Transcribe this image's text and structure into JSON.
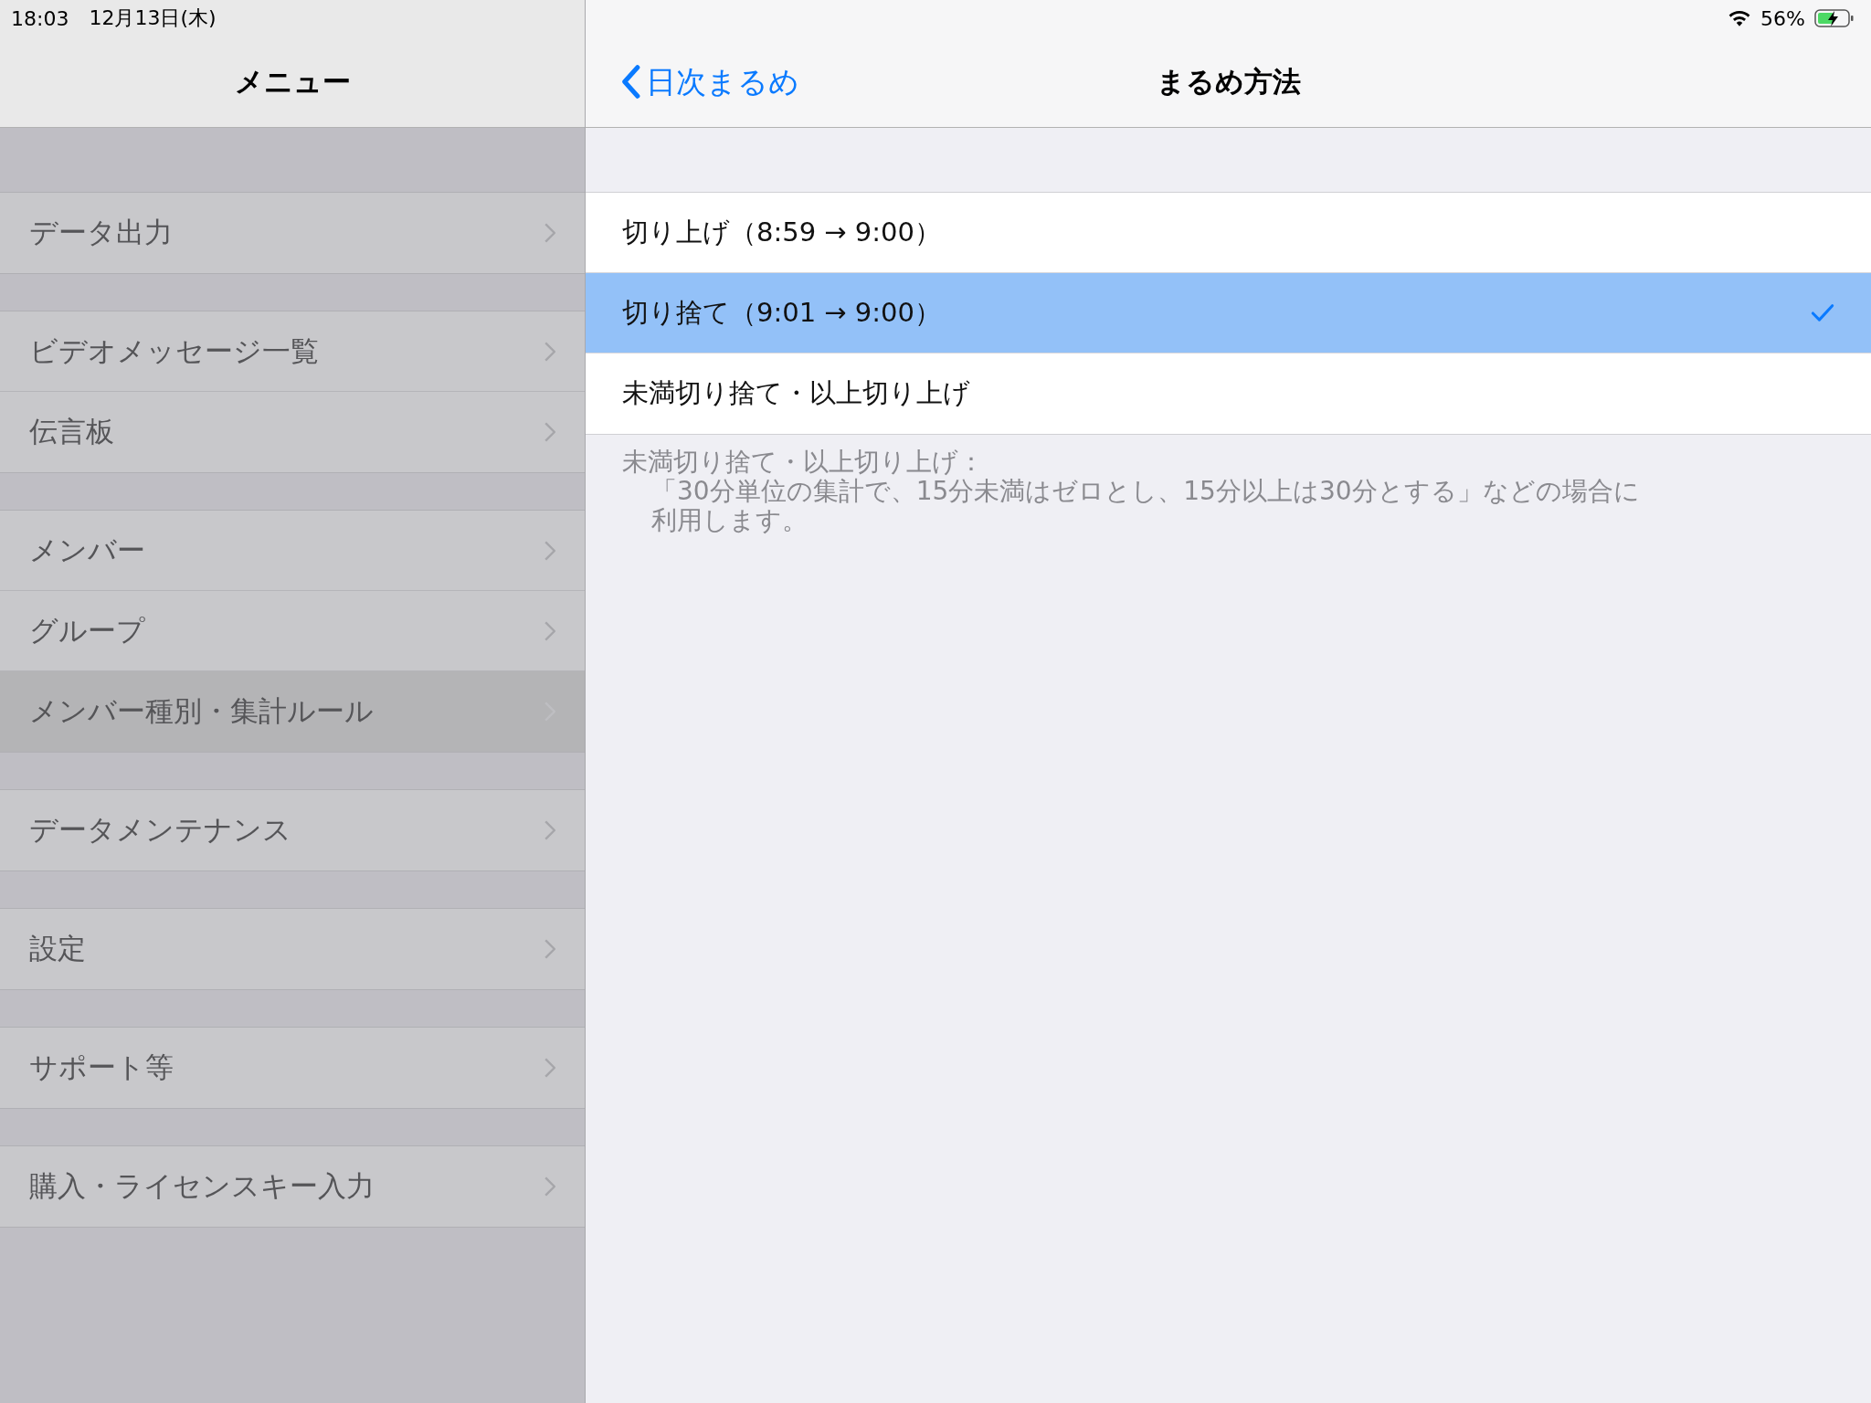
{
  "status_bar": {
    "time": "18:03",
    "date": "12月13日(木)",
    "battery": "56%"
  },
  "sidebar": {
    "title": "メニュー",
    "sections": [
      {
        "items": [
          {
            "label": "データ出力",
            "selected": false
          }
        ]
      },
      {
        "items": [
          {
            "label": "ビデオメッセージ一覧",
            "selected": false
          },
          {
            "label": "伝言板",
            "selected": false
          }
        ]
      },
      {
        "items": [
          {
            "label": "メンバー",
            "selected": false
          },
          {
            "label": "グループ",
            "selected": false
          },
          {
            "label": "メンバー種別・集計ルール",
            "selected": true
          }
        ]
      },
      {
        "items": [
          {
            "label": "データメンテナンス",
            "selected": false
          }
        ]
      },
      {
        "items": [
          {
            "label": "設定",
            "selected": false
          }
        ]
      },
      {
        "items": [
          {
            "label": "サポート等",
            "selected": false
          }
        ]
      },
      {
        "items": [
          {
            "label": "購入・ライセンスキー入力",
            "selected": false
          }
        ]
      }
    ]
  },
  "detail": {
    "back": "日次まるめ",
    "title": "まるめ方法",
    "options": [
      {
        "label": "切り上げ（8:59 → 9:00）",
        "selected": false
      },
      {
        "label": "切り捨て（9:01 → 9:00）",
        "selected": true
      },
      {
        "label": "未満切り捨て・以上切り上げ",
        "selected": false
      }
    ],
    "footer": [
      "未満切り捨て・以上切り上げ：",
      "「30分単位の集計で、15分未満はゼロとし、15分以上は30分とする」などの場合に",
      "利用します。"
    ]
  }
}
